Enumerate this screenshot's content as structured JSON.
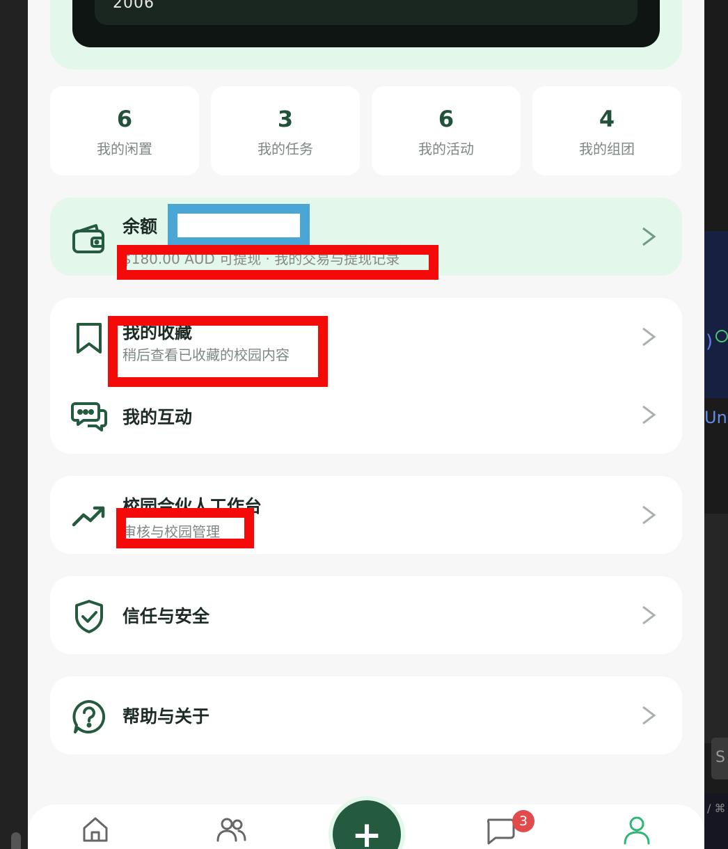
{
  "hero": {
    "year": "2006"
  },
  "stats": [
    {
      "value": "6",
      "label": "我的闲置"
    },
    {
      "value": "3",
      "label": "我的任务"
    },
    {
      "value": "6",
      "label": "我的活动"
    },
    {
      "value": "4",
      "label": "我的组团"
    }
  ],
  "balance": {
    "title": "余额",
    "subtitle": "$180.00 AUD 可提现 · 我的交易与提现记录",
    "icon": "wallet-icon"
  },
  "menu": {
    "favorites": {
      "title": "我的收藏",
      "subtitle": "稍后查看已收藏的校园内容",
      "icon": "bookmark-icon"
    },
    "interactions": {
      "title": "我的互动",
      "icon": "chat-bubbles-icon"
    },
    "partner": {
      "title": "校园合伙人工作台",
      "subtitle": "审核与校园管理",
      "icon": "trending-up-icon"
    },
    "trust": {
      "title": "信任与安全",
      "icon": "shield-check-icon"
    },
    "help": {
      "title": "帮助与关于",
      "icon": "help-circle-icon"
    }
  },
  "tabbar": {
    "items": [
      "home-icon",
      "people-icon",
      "plus-icon",
      "message-icon",
      "profile-icon"
    ],
    "fab_label": "+",
    "message_badge": "3",
    "active": "profile",
    "accent_color": "#2fb673",
    "brand_color": "#245b3f"
  },
  "background_window": {
    "partial_text": "Unre"
  }
}
